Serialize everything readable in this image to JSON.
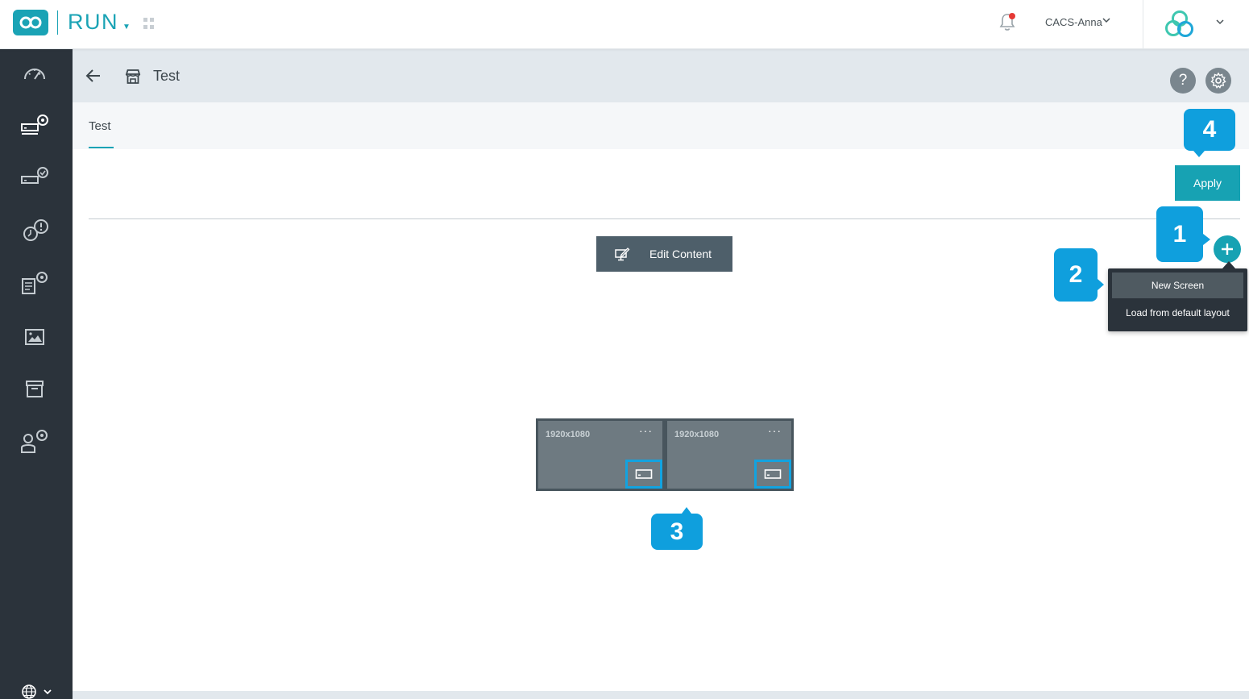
{
  "topbar": {
    "app_name": "RUN",
    "user_name": "CACS-Anna",
    "accent": "#1aa3b5"
  },
  "sidebar": {
    "items": [
      {
        "icon": "speedometer-icon"
      },
      {
        "icon": "player-settings-icon"
      },
      {
        "icon": "player-check-icon"
      },
      {
        "icon": "alert-clock-icon"
      },
      {
        "icon": "document-settings-icon"
      },
      {
        "icon": "media-image-icon"
      },
      {
        "icon": "archive-box-icon"
      },
      {
        "icon": "user-settings-icon"
      }
    ],
    "bottom_icon": "globe-icon"
  },
  "page": {
    "title": "Test",
    "tab_label": "Test",
    "help_label": "?",
    "apply_label": "Apply",
    "edit_content_label": "Edit Content"
  },
  "add_menu": {
    "items": [
      "New Screen",
      "Load from default layout"
    ]
  },
  "screens": [
    {
      "resolution": "1920x1080",
      "more": "···"
    },
    {
      "resolution": "1920x1080",
      "more": "···"
    }
  ],
  "callouts": {
    "one": "1",
    "two": "2",
    "three": "3",
    "four": "4",
    "color": "#0f9fdd"
  }
}
